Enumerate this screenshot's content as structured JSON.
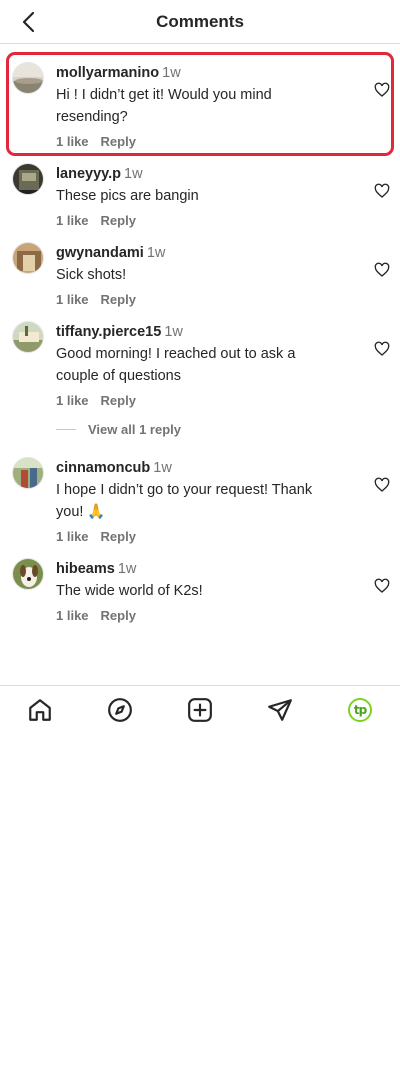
{
  "header": {
    "title": "Comments",
    "back_icon": "chevron-left-icon"
  },
  "comments": [
    {
      "username": "mollyarmanino",
      "time": "1w",
      "text_lines": [
        "Hi ! I didn’t get it! Would you mind",
        "resending?"
      ],
      "likes": "1 like",
      "reply": "Reply",
      "highlighted": true
    },
    {
      "username": "laneyyy.p",
      "time": "1w",
      "text_lines": [
        "These pics are bangin"
      ],
      "likes": "1 like",
      "reply": "Reply"
    },
    {
      "username": "gwynandami",
      "time": "1w",
      "text_lines": [
        "Sick shots!"
      ],
      "likes": "1 like",
      "reply": "Reply"
    },
    {
      "username": "tiffany.pierce15",
      "time": "1w",
      "text_lines": [
        "Good morning! I reached out to ask a",
        "couple of questions"
      ],
      "likes": "1 like",
      "reply": "Reply",
      "view_replies": "View all 1 reply"
    },
    {
      "username": "cinnamoncub",
      "time": "1w",
      "text_lines": [
        "I hope I didn’t go to your request! Thank",
        "you! 🙏"
      ],
      "likes": "1 like",
      "reply": "Reply"
    },
    {
      "username": "hibeams",
      "time": "1w",
      "text_lines": [
        "The wide world of K2s!"
      ],
      "likes": "1 like",
      "reply": "Reply"
    }
  ],
  "nav": {
    "items": [
      "home-icon",
      "explore-icon",
      "create-icon",
      "direct-icon",
      "profile-avatar"
    ],
    "profile_initials": "tp"
  },
  "colors": {
    "highlight": "#e0283a",
    "profile_ring": "#7ed321"
  }
}
